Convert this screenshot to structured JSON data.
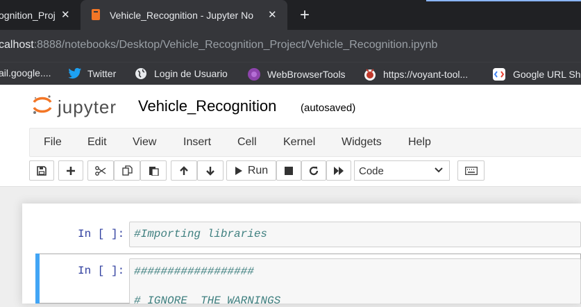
{
  "browser": {
    "tabs": [
      {
        "title": "ognition_Proj",
        "close": "✕"
      },
      {
        "title": "Vehicle_Recognition - Jupyter No",
        "close": "✕"
      }
    ],
    "new_tab": "+",
    "url_host": "calhost",
    "url_path": ":8888/notebooks/Desktop/Vehicle_Recognition_Project/Vehicle_Recognition.ipynb",
    "bookmarks": [
      {
        "label": "ail.google....",
        "icon": "gmail-icon",
        "color": "#ea4335"
      },
      {
        "label": "Twitter",
        "icon": "twitter-icon",
        "color": "#1da1f2"
      },
      {
        "label": "Login de Usuario",
        "icon": "globe-icon",
        "color": "#e8eaed"
      },
      {
        "label": "WebBrowserTools",
        "icon": "webbrowsertools-icon",
        "color": "#8e44ad"
      },
      {
        "label": "https://voyant-tool...",
        "icon": "voyant-icon",
        "color": "#c0392b"
      },
      {
        "label": "Google URL Sh",
        "icon": "google-url-icon",
        "color": "#ffffff"
      }
    ]
  },
  "jupyter": {
    "logo_text": "jupyter",
    "notebook_name": "Vehicle_Recognition",
    "autosave_status": "(autosaved)",
    "menu": [
      "File",
      "Edit",
      "View",
      "Insert",
      "Cell",
      "Kernel",
      "Widgets",
      "Help"
    ],
    "toolbar": {
      "run_label": "Run",
      "cell_type": "Code"
    },
    "cells": [
      {
        "prompt": "In [ ]:",
        "code": "#Importing libraries"
      },
      {
        "prompt": "In [ ]:",
        "code": "##################",
        "code2": "# IGNORE  THE WARNINGS"
      }
    ]
  },
  "colors": {
    "tab_bar": "#202124",
    "chrome": "#35363a",
    "jupyter_orange": "#f37626",
    "prompt_blue": "#303f9f",
    "comment_teal": "#408080",
    "selected_cell_bar": "#42a5f5"
  }
}
